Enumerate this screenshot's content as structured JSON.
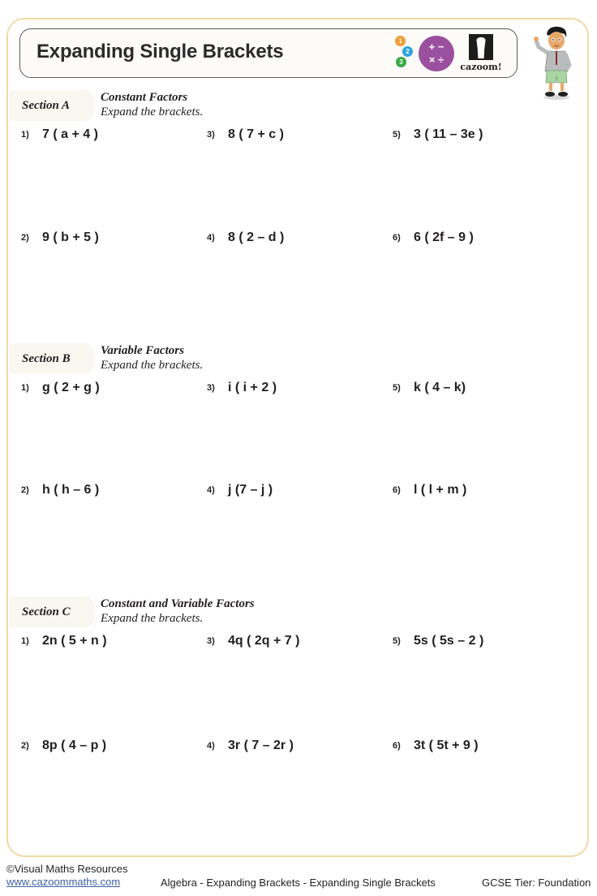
{
  "header": {
    "title": "Expanding Single Brackets",
    "logo_numbers": [
      "1",
      "2",
      "3"
    ],
    "logo_ops": [
      "+",
      "−",
      "×",
      "÷"
    ],
    "brand": "cazoom!"
  },
  "sections": [
    {
      "label": "Section A",
      "heading": "Constant Factors",
      "instruction": "Expand the brackets.",
      "questions": [
        {
          "num": "1)",
          "expr": "7 ( a + 4 )"
        },
        {
          "num": "2)",
          "expr": "9 ( b + 5 )"
        },
        {
          "num": "3)",
          "expr": "8 ( 7 + c )"
        },
        {
          "num": "4)",
          "expr": "8 ( 2 – d )"
        },
        {
          "num": "5)",
          "expr": "3 ( 11 – 3e )"
        },
        {
          "num": "6)",
          "expr": "6 ( 2f – 9 )"
        }
      ]
    },
    {
      "label": "Section B",
      "heading": "Variable Factors",
      "instruction": "Expand the brackets.",
      "questions": [
        {
          "num": "1)",
          "expr": "g ( 2 + g )"
        },
        {
          "num": "2)",
          "expr": "h ( h – 6 )"
        },
        {
          "num": "3)",
          "expr": "i ( i + 2 )"
        },
        {
          "num": "4)",
          "expr": "j (7 – j )"
        },
        {
          "num": "5)",
          "expr": "k ( 4 – k)"
        },
        {
          "num": "6)",
          "expr": "l ( l + m )"
        }
      ]
    },
    {
      "label": "Section C",
      "heading": "Constant and Variable Factors",
      "instruction": "Expand the brackets.",
      "questions": [
        {
          "num": "1)",
          "expr": "2n ( 5 + n )"
        },
        {
          "num": "2)",
          "expr": "8p ( 4 – p )"
        },
        {
          "num": "3)",
          "expr": "4q ( 2q + 7 )"
        },
        {
          "num": "4)",
          "expr": "3r ( 7 – 2r )"
        },
        {
          "num": "5)",
          "expr": "5s ( 5s – 2 )"
        },
        {
          "num": "6)",
          "expr": "3t ( 5t + 9 )"
        }
      ]
    }
  ],
  "footer": {
    "copyright": "©Visual Maths Resources",
    "website": "www.cazoommaths.com",
    "topic": "Algebra - Expanding Brackets - Expanding Single Brackets",
    "tier": "GCSE Tier: Foundation"
  },
  "colors": {
    "frame": "#f1d9a3",
    "ops_circle": "#9b4f9f",
    "num1": "#f39c32",
    "num2": "#2ea3dc",
    "num3": "#3aa847",
    "link": "#3b5fa8"
  }
}
